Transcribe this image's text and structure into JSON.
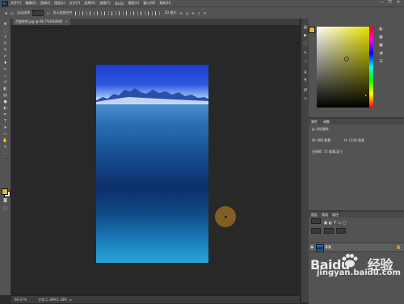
{
  "app": {
    "logo": "Ps"
  },
  "menubar": {
    "items": [
      "文件(F)",
      "编辑(E)",
      "图像(I)",
      "图层(L)",
      "文字(Y)",
      "选择(S)",
      "滤镜(T)",
      "3D(D)",
      "视图(V)",
      "窗口(W)",
      "帮助(H)"
    ]
  },
  "window_controls": {
    "minimize": "—",
    "restore": "❐",
    "close": "✕"
  },
  "options_bar": {
    "auto_select_label": "自动选择",
    "transform_label": "显示变换控件",
    "mode_3d": "3D 模式"
  },
  "document_tab": {
    "label": "百度经验.jpg @ 66.7%(RGB/8)",
    "close": "×"
  },
  "status": {
    "zoom": "66.67%",
    "doc_info": "文档:1.38M/1.38M"
  },
  "properties": {
    "tabs": [
      "属性",
      "调整"
    ],
    "subtitle": "文档属性",
    "width_label": "W:",
    "width_value": "488 像素",
    "height_label": "H:",
    "height_value": "1148 像素",
    "resolution": "分辨率: 72 像素/英寸"
  },
  "layers": {
    "tabs": [
      "图层",
      "通道",
      "路径"
    ],
    "layer_name": "背景"
  },
  "colors": {
    "foreground": "#e2b83a",
    "background": "#f2f2f2",
    "picker_hue": "#e8e200"
  },
  "watermark": {
    "brand": "Baidu",
    "suffix": "经验",
    "url": "jingyan.baidu.com"
  }
}
